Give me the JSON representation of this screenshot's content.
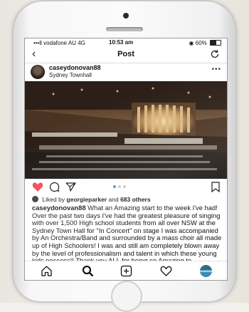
{
  "status_bar": {
    "carrier": "•••ll vodafone AU 4G",
    "time": "10:53 am",
    "battery": "◉ 60%",
    "battery_level": 0.6
  },
  "nav": {
    "back_icon": "chevron-left-icon",
    "title": "Post",
    "refresh_icon": "refresh-icon"
  },
  "post": {
    "username": "caseydonovan88",
    "location": "Sydney Townhall",
    "more_icon": "more-dots-icon",
    "photo_description_icon": "concert-hall-photo",
    "carousel_page": 1,
    "carousel_count": 3,
    "liked_by_prefix": "Liked by",
    "liked_by_user": "georgieparker",
    "liked_by_conjunction": "and",
    "liked_by_others": "683 others",
    "caption_user": "caseydonovan88",
    "caption_text": "What an Amazing start to the week I've had! Over the past two days I've had the greatest pleasure of singing with over 1,500 High school students from all over NSW at the Sydney Town Hall for \"In Concert\" on stage I was accompanied by An Orchestra/Band and surrounded by a mass choir all made up of High Schoolers! I was and still am completely blown away by the level of professionalism and talent in which these young kids possess!! Thank you ALL for being so Amazing to"
  },
  "colors": {
    "like_red": "#ed4956",
    "text": "#111111"
  },
  "tabs": [
    {
      "name": "home-icon"
    },
    {
      "name": "search-icon"
    },
    {
      "name": "add-post-icon"
    },
    {
      "name": "activity-heart-icon"
    },
    {
      "name": "profile-avatar-icon"
    }
  ]
}
